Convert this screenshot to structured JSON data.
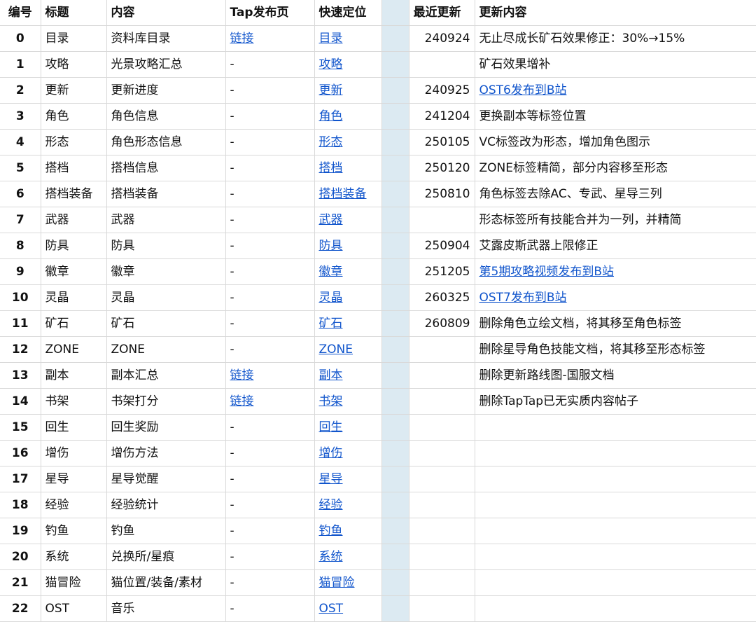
{
  "headers": {
    "num": "编号",
    "title": "标题",
    "content": "内容",
    "tap": "Tap发布页",
    "quick": "快速定位",
    "gap": "",
    "recent": "最近更新",
    "update": "更新内容"
  },
  "rows": [
    {
      "num": "0",
      "title": "目录",
      "content": "资料库目录",
      "tap": "链接",
      "quick": "目录",
      "date": "240924",
      "note": "无止尽成长矿石效果修正：30%→15%"
    },
    {
      "num": "1",
      "title": "攻略",
      "content": "光景攻略汇总",
      "tap": "-",
      "quick": "攻略",
      "date": "",
      "note": "矿石效果增补"
    },
    {
      "num": "2",
      "title": "更新",
      "content": "更新进度",
      "tap": "-",
      "quick": "更新",
      "date": "240925",
      "note": "OST6发布到B站"
    },
    {
      "num": "3",
      "title": "角色",
      "content": "角色信息",
      "tap": "-",
      "quick": "角色",
      "date": "241204",
      "note": "更换副本等标签位置"
    },
    {
      "num": "4",
      "title": "形态",
      "content": "角色形态信息",
      "tap": "-",
      "quick": "形态",
      "date": "250105",
      "note": "VC标签改为形态，增加角色图示"
    },
    {
      "num": "5",
      "title": "搭档",
      "content": "搭档信息",
      "tap": "-",
      "quick": "搭档",
      "date": "250120",
      "note": "ZONE标签精简，部分内容移至形态"
    },
    {
      "num": "6",
      "title": "搭档装备",
      "content": "搭档装备",
      "tap": "-",
      "quick": "搭档装备",
      "date": "250810",
      "note": "角色标签去除AC、专武、星导三列"
    },
    {
      "num": "7",
      "title": "武器",
      "content": "武器",
      "tap": "-",
      "quick": "武器",
      "date": "",
      "note": "形态标签所有技能合并为一列，并精简"
    },
    {
      "num": "8",
      "title": "防具",
      "content": "防具",
      "tap": "-",
      "quick": "防具",
      "date": "250904",
      "note": "艾露皮斯武器上限修正"
    },
    {
      "num": "9",
      "title": "徽章",
      "content": "徽章",
      "tap": "-",
      "quick": "徽章",
      "date": "251205",
      "note": "第5期攻略视频发布到B站"
    },
    {
      "num": "10",
      "title": "灵晶",
      "content": "灵晶",
      "tap": "-",
      "quick": "灵晶",
      "date": "260325",
      "note": "OST7发布到B站"
    },
    {
      "num": "11",
      "title": "矿石",
      "content": "矿石",
      "tap": "-",
      "quick": "矿石",
      "date": "260809",
      "note": "删除角色立绘文档，将其移至角色标签"
    },
    {
      "num": "12",
      "title": "ZONE",
      "content": "ZONE",
      "tap": "-",
      "quick": "ZONE",
      "date": "",
      "note": "删除星导角色技能文档，将其移至形态标签"
    },
    {
      "num": "13",
      "title": "副本",
      "content": "副本汇总",
      "tap": "链接",
      "quick": "副本",
      "date": "",
      "note": "删除更新路线图-国服文档"
    },
    {
      "num": "14",
      "title": "书架",
      "content": "书架打分",
      "tap": "链接",
      "quick": "书架",
      "date": "",
      "note": "删除TapTap已无实质内容帖子"
    },
    {
      "num": "15",
      "title": "回生",
      "content": "回生奖励",
      "tap": "-",
      "quick": "回生",
      "date": "",
      "note": ""
    },
    {
      "num": "16",
      "title": "增伤",
      "content": "增伤方法",
      "tap": "-",
      "quick": "增伤",
      "date": "",
      "note": ""
    },
    {
      "num": "17",
      "title": "星导",
      "content": "星导觉醒",
      "tap": "-",
      "quick": "星导",
      "date": "",
      "note": ""
    },
    {
      "num": "18",
      "title": "经验",
      "content": "经验统计",
      "tap": "-",
      "quick": "经验",
      "date": "",
      "note": ""
    },
    {
      "num": "19",
      "title": "钓鱼",
      "content": "钓鱼",
      "tap": "-",
      "quick": "钓鱼",
      "date": "",
      "note": ""
    },
    {
      "num": "20",
      "title": "系统",
      "content": "兑换所/星痕",
      "tap": "-",
      "quick": "系统",
      "date": "",
      "note": ""
    },
    {
      "num": "21",
      "title": "猫冒险",
      "content": "猫位置/装备/素材",
      "tap": "-",
      "quick": "猫冒险",
      "date": "",
      "note": ""
    },
    {
      "num": "22",
      "title": "OST",
      "content": "音乐",
      "tap": "-",
      "quick": "OST",
      "date": "",
      "note": ""
    }
  ],
  "linked_notes": [
    "OST6发布到B站",
    "第5期攻略视频发布到B站",
    "OST7发布到B站"
  ],
  "colors": {
    "link": "#1155cc",
    "gap_column": "#dceaf2",
    "grid_line": "#d9d9d9"
  }
}
